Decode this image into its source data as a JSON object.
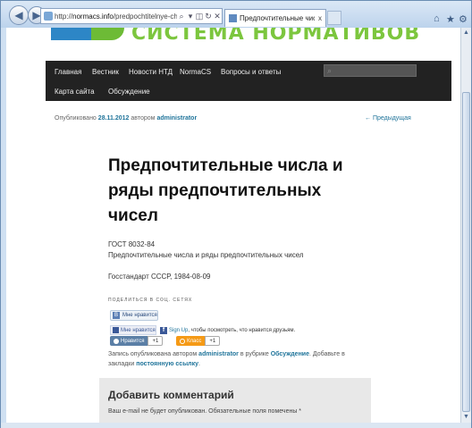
{
  "browser": {
    "url_prefix": "http://",
    "url_domain": "normacs.info",
    "url_path": "/predpochtitelnye-chisla-i-ryadi",
    "tab_title": "Предпочтительные числа ...",
    "tab_close": "x"
  },
  "site": {
    "logo_text": "СИСТЕМА НОРМАТИВОВ",
    "menu": [
      "Главная",
      "Вестник",
      "Новости НТД",
      "NormaCS",
      "Вопросы и ответы",
      "Карта сайта",
      "Обсуждение"
    ]
  },
  "post": {
    "meta_prefix": "Опубликовано",
    "date": "28.11.2012",
    "by": "автором",
    "author": "administrator",
    "prev_link": "← Предыдущая",
    "title": "Предпочтительные числа и ряды предпочтительных чисел",
    "lines": [
      "ГОСТ 8032-84",
      "Предпочтительные числа и ряды предпочтительных чисел",
      "Госстандарт СССР, 1984-08-09"
    ]
  },
  "social": {
    "share_heading": "ПОДЕЛИТЬСЯ В СОЦ. СЕТЯХ",
    "vk_like": "Мне нравится",
    "fb_like": "Мне нравится",
    "fb_signup": "Sign Up",
    "fb_text": ", чтобы посмотреть, что нравится друзьям.",
    "vk_recommend": "Нравится",
    "vk_count": "+1",
    "ok_label": "Класс",
    "ok_count": "+1"
  },
  "footer": {
    "text1": "Запись опубликована автором",
    "author": "administrator",
    "text2": "в рубрике",
    "category": "Обсуждение",
    "text3": ". Добавьте в закладки",
    "permalink": "постоянную ссылку",
    "end": "."
  },
  "comments": {
    "heading": "Добавить комментарий",
    "note": "Ваш e-mail не будет опубликован. Обязательные поля помечены *"
  }
}
